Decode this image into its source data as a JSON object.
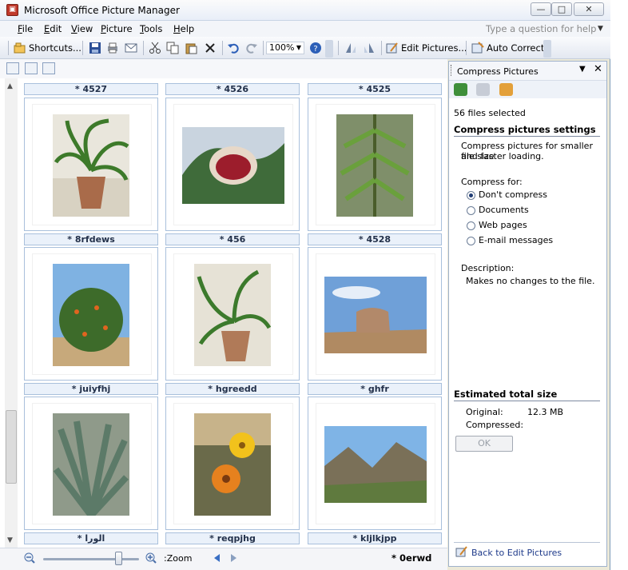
{
  "window": {
    "title": "Microsoft Office Picture Manager",
    "min": "—",
    "max": "□",
    "close": "✕"
  },
  "menu": {
    "items": [
      {
        "pre": "",
        "u": "F",
        "post": "ile"
      },
      {
        "pre": "",
        "u": "E",
        "post": "dit"
      },
      {
        "pre": "",
        "u": "V",
        "post": "iew"
      },
      {
        "pre": "",
        "u": "P",
        "post": "icture"
      },
      {
        "pre": "",
        "u": "T",
        "post": "ools"
      },
      {
        "pre": "",
        "u": "H",
        "post": "elp"
      }
    ],
    "help_placeholder": "Type a question for help"
  },
  "toolbar": {
    "shortcuts": "Shortcuts...",
    "zoom": "100%",
    "edit_pictures": "Edit Pictures...",
    "auto_correct": "Auto Correct"
  },
  "thumbnails": {
    "top_captions": [
      "* 4527",
      "* 4526",
      "* 4525"
    ],
    "rows": [
      [
        "* 8rfdews",
        "* 456",
        "* 4528"
      ],
      [
        "* juiyfhj",
        "* hgreedd",
        "* ghfr"
      ],
      [
        "* الورا",
        "* reqpjhg",
        "* kljlkjpp"
      ]
    ]
  },
  "statusbar": {
    "zoom_label": ":Zoom",
    "current_name": "* 0erwd",
    "zoom_level": 0.78
  },
  "pane": {
    "title": "Compress Pictures",
    "files_selected": "56 files selected",
    "settings_heading": "Compress pictures settings",
    "settings_desc_1": "Compress pictures for smaller file size",
    "settings_desc_2": "and faster loading.",
    "compress_for_label": "Compress for:",
    "options": [
      "Don't compress",
      "Documents",
      "Web pages",
      "E-mail messages"
    ],
    "selected_option": 0,
    "description_label": "Description:",
    "description_text": "Makes no changes to the file.",
    "estimated_heading": "Estimated total size",
    "original_label": "Original:",
    "original_value": "12.3 MB",
    "compressed_label": "Compressed:",
    "compressed_value": "",
    "ok_label": "OK",
    "back_link": "Back to Edit Pictures"
  },
  "colors": {
    "caption_bg": "#eaf1fa",
    "caption_border": "#a9c0dc",
    "radio_dot": "#1f3c74",
    "link": "#1e3a8a"
  }
}
